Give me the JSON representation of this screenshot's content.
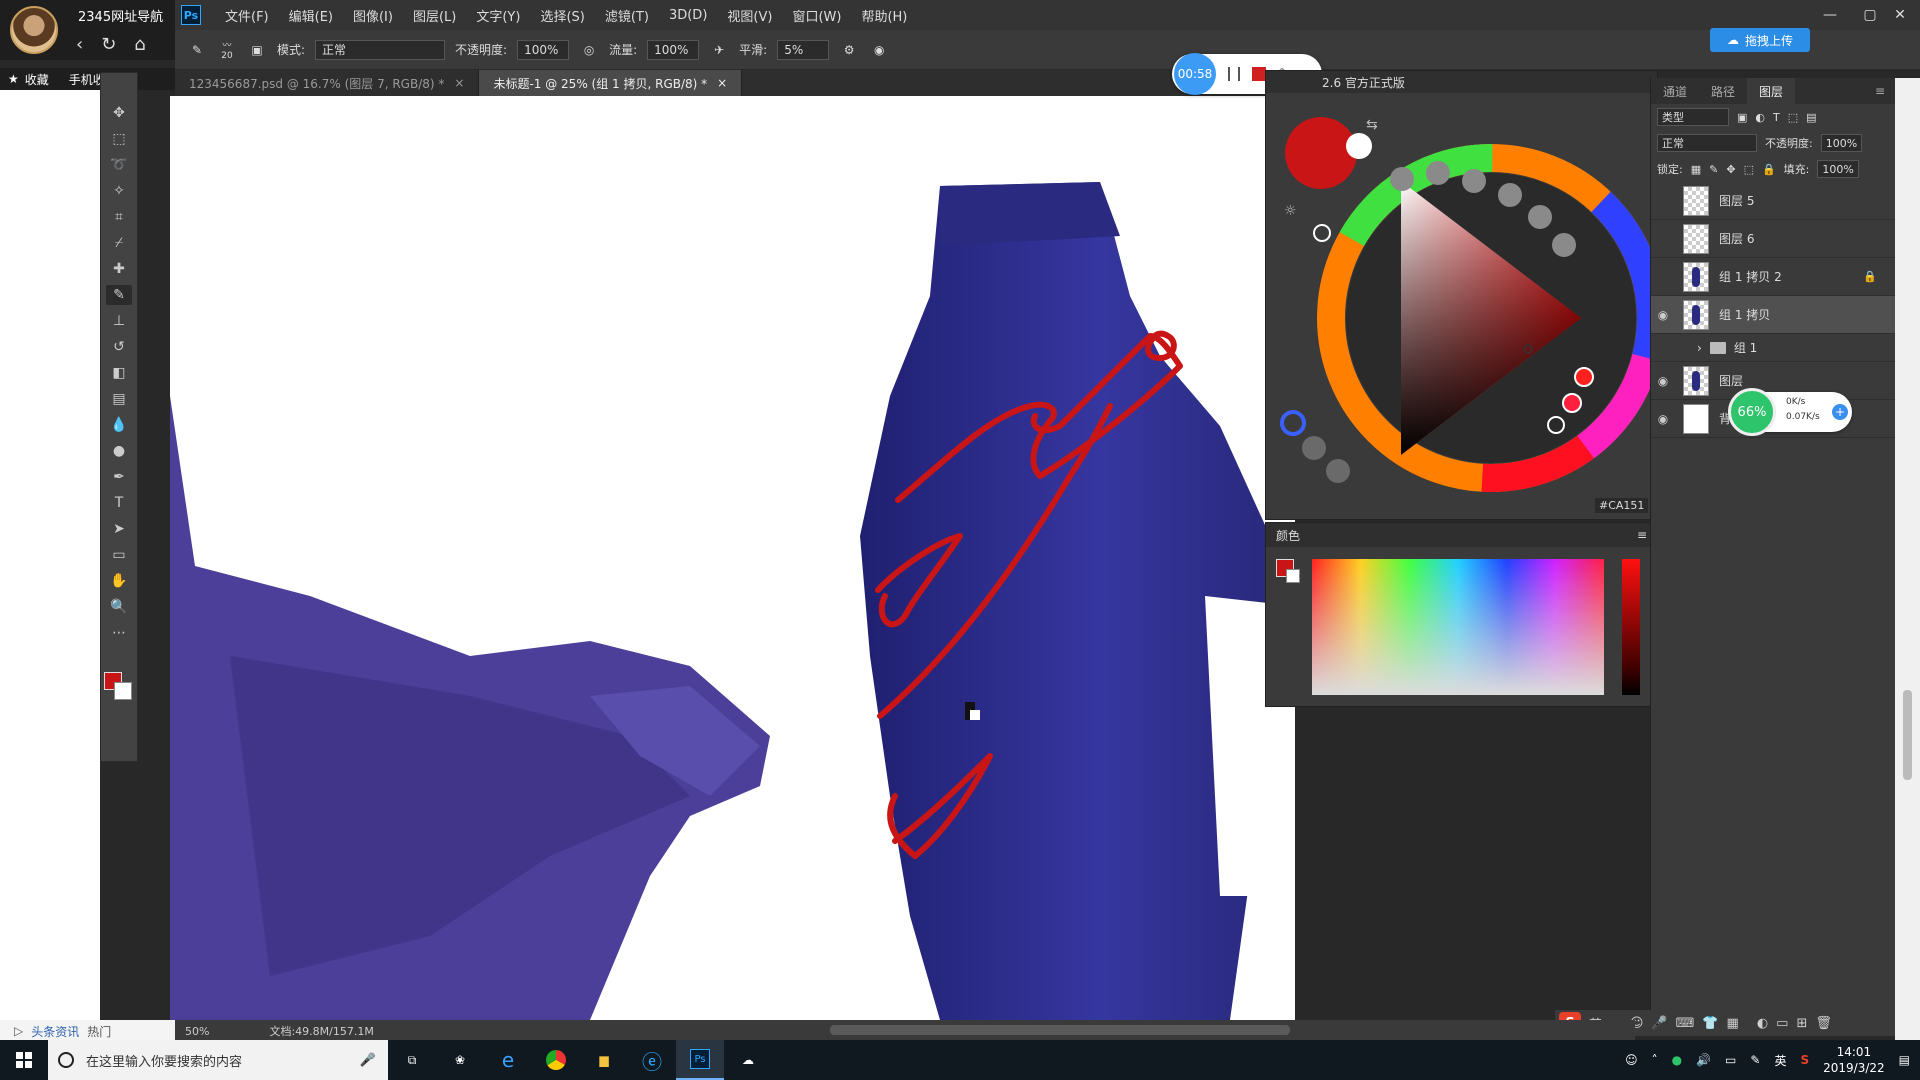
{
  "browser": {
    "tab_title": "2345网址导航",
    "bookmarks_label": "收藏",
    "bookmarks_item": "手机收藏夹",
    "status_news": "头条资讯",
    "status_hot": "热门"
  },
  "menubar": {
    "items": [
      "文件(F)",
      "编辑(E)",
      "图像(I)",
      "图层(L)",
      "文字(Y)",
      "选择(S)",
      "滤镜(T)",
      "3D(D)",
      "视图(V)",
      "窗口(W)",
      "帮助(H)"
    ],
    "ps_label": "Ps"
  },
  "options": {
    "brush_size": "20",
    "mode_label": "模式:",
    "mode_value": "正常",
    "opacity_label": "不透明度:",
    "opacity_value": "100%",
    "flow_label": "流量:",
    "flow_value": "100%",
    "smooth_label": "平滑:",
    "smooth_value": "5%",
    "upload_label": "拖拽上传"
  },
  "doc_tabs": [
    {
      "label": "123456687.psd @ 16.7% (图层 7, RGB/8) *"
    },
    {
      "label": "未标题-1 @ 25% (组 1 拷贝, RGB/8) *"
    }
  ],
  "timer": {
    "time": "00:58"
  },
  "wheel_panel": {
    "title": "2.6 官方正式版",
    "hex": "#CA151"
  },
  "color_panel": {
    "title": "颜色"
  },
  "layers": {
    "tabs": [
      "通道",
      "路径",
      "图层"
    ],
    "kind_label": "类型",
    "blend_mode": "正常",
    "opacity_label": "不透明度:",
    "opacity_value": "100%",
    "lock_label": "锁定:",
    "fill_label": "填充:",
    "fill_value": "100%",
    "rows": [
      {
        "name": "图层 5"
      },
      {
        "name": "图层 6"
      },
      {
        "name": "组 1 拷贝 2"
      },
      {
        "name": "组 1 拷贝"
      },
      {
        "name": "组 1"
      },
      {
        "name": "图层"
      },
      {
        "name": "背景"
      }
    ]
  },
  "net_widget": {
    "percent": "66%",
    "up": "0K/s",
    "down": "0.07K/s"
  },
  "ps_status": {
    "zoom": "50%",
    "doc": "文档:49.8M/157.1M"
  },
  "ime": {
    "lang": "英"
  },
  "taskbar": {
    "search_placeholder": "在这里输入你要搜索的内容",
    "tray_lang": "英",
    "time": "14:01",
    "date": "2019/3/22"
  },
  "colors": {
    "foreground": "#CA1516",
    "accent_blue": "#3B9BF5",
    "fabric_navy": "#2C2C7E",
    "fabric_violet": "#4B3F9A"
  }
}
